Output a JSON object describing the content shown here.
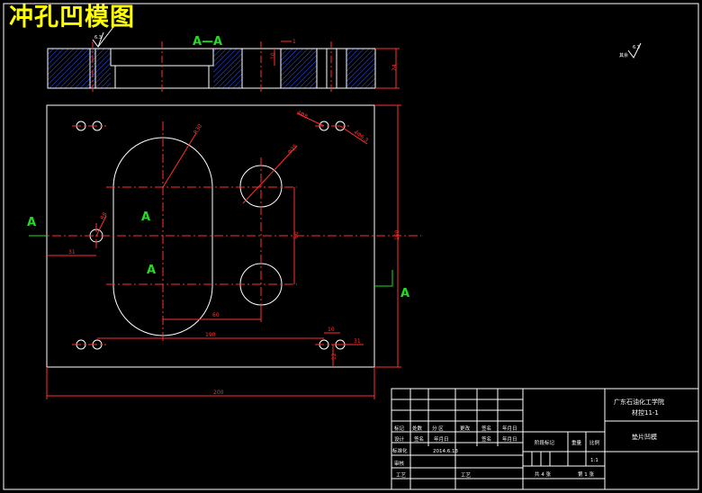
{
  "title": "冲孔凹模图",
  "section_label": "A—A",
  "section_marks": [
    "A",
    "A",
    "A",
    "A"
  ],
  "roughness": {
    "top_symbol": "6.3",
    "corner_symbol": "6.3",
    "corner_prefix": "其余"
  },
  "dims": {
    "d_r100": "R30",
    "d_phi25": "Φ25",
    "d_4phi8": "4Φ8",
    "d_4phi6": "4Φ6.3",
    "d_r8": "R8",
    "d_31": "31",
    "d_60": "60",
    "d_60b": "60",
    "d_190": "190",
    "d_10": "10",
    "d_12": "12",
    "d_31b": "31",
    "d_160": "160",
    "d_200": "200",
    "d_1": "1",
    "d_10s": "10",
    "d_24": "24"
  },
  "title_block": {
    "school": "广东石油化工学院",
    "class": "材控11-1",
    "drawing_name": "垫片凹模",
    "scale": "1:1",
    "sheets_total": "共 4 张",
    "sheet_no": "第 1 张",
    "stage_mark": "阶段标记",
    "weight": "重量",
    "scale_label": "比例",
    "row1": [
      "标记",
      "处数",
      "分 区",
      "更改",
      "签名",
      "年月日"
    ],
    "row2": [
      "设计",
      "签名",
      "年月日",
      "",
      "签名",
      "年月日"
    ],
    "std_label": "标准化",
    "std_date": "2014.6.13",
    "review": "审核",
    "process": "工艺",
    "approve": "工艺"
  }
}
